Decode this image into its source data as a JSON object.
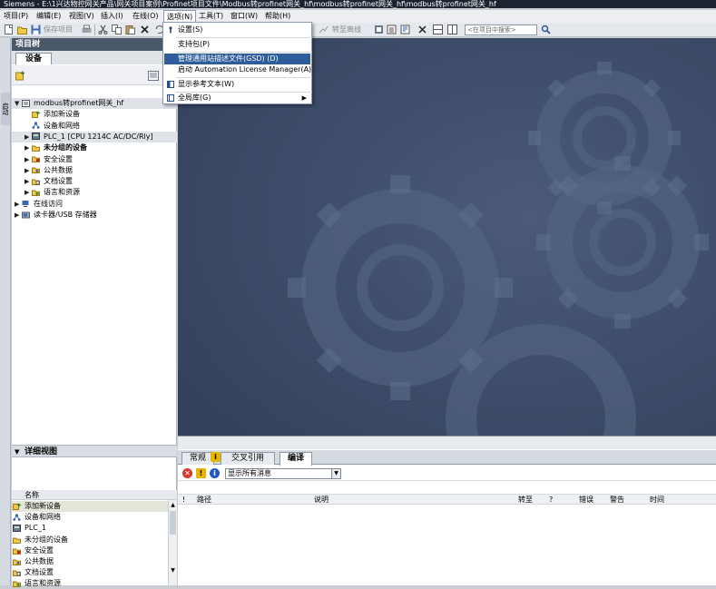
{
  "window": {
    "title": "Siemens  -  E:\\1兴达物控网关产品\\网关项目案例\\Profinet项目文件\\Modbus转profinet网关_hf\\modbus转profinet网关_hf\\modbus转profinet网关_hf"
  },
  "menubar": {
    "items": [
      "项目(P)",
      "编辑(E)",
      "视图(V)",
      "插入(I)",
      "在线(O)",
      "选项(N)",
      "工具(T)",
      "窗口(W)",
      "帮助(H)"
    ]
  },
  "toolbar": {
    "save_project": "保存项目",
    "go_offline": "转至离线",
    "search_placeholder": "<在项目中搜索>"
  },
  "options_menu": {
    "items": [
      {
        "label": "设置(S)",
        "icon": "settings-icon"
      },
      {
        "label": "支持包(P)",
        "icon": ""
      },
      {
        "label": "管理通用站描述文件(GSD) (D)",
        "icon": "",
        "highlighted": true
      },
      {
        "label": "启动 Automation License Manager(A)",
        "icon": ""
      },
      {
        "label": "显示参考文本(W)",
        "icon": "reference-text-icon"
      },
      {
        "label": "全局库(G)",
        "icon": "library-icon",
        "submenu": true
      }
    ]
  },
  "left_strip": {
    "label": "启动"
  },
  "project_tree": {
    "title": "项目树",
    "tab": "设备",
    "items": [
      {
        "label": "modbus转profinet网关_hf",
        "level": 0,
        "twisty": "open",
        "icon": "project-icon",
        "bold": false,
        "selected": true
      },
      {
        "label": "添加新设备",
        "level": 1,
        "twisty": "",
        "icon": "add-device-icon",
        "bold": false
      },
      {
        "label": "设备和网络",
        "level": 1,
        "twisty": "",
        "icon": "network-icon",
        "bold": false
      },
      {
        "label": "PLC_1 [CPU 1214C AC/DC/Rly]",
        "level": 1,
        "twisty": "closed",
        "icon": "plc-icon",
        "bold": false,
        "selected": true
      },
      {
        "label": "未分组的设备",
        "level": 1,
        "twisty": "closed",
        "icon": "folder-icon",
        "bold": true
      },
      {
        "label": "安全设置",
        "level": 1,
        "twisty": "closed",
        "icon": "security-icon",
        "bold": false
      },
      {
        "label": "公共数据",
        "level": 1,
        "twisty": "closed",
        "icon": "common-data-icon",
        "bold": false
      },
      {
        "label": "文档设置",
        "level": 1,
        "twisty": "closed",
        "icon": "document-icon",
        "bold": false
      },
      {
        "label": "语言和资源",
        "level": 1,
        "twisty": "closed",
        "icon": "language-icon",
        "bold": false
      },
      {
        "label": "在线访问",
        "level": 0,
        "twisty": "closed",
        "icon": "online-access-icon",
        "bold": false
      },
      {
        "label": "读卡器/USB 存储器",
        "level": 0,
        "twisty": "closed",
        "icon": "card-reader-icon",
        "bold": false
      }
    ]
  },
  "detail_view": {
    "title": "详细视图",
    "column": "名称",
    "items": [
      {
        "label": "添加新设备",
        "icon": "add-device-icon",
        "selected": true
      },
      {
        "label": "设备和网络",
        "icon": "network-icon"
      },
      {
        "label": "PLC_1",
        "icon": "plc-icon"
      },
      {
        "label": "未分组的设备",
        "icon": "folder-icon"
      },
      {
        "label": "安全设置",
        "icon": "security-icon"
      },
      {
        "label": "公共数据",
        "icon": "common-data-icon"
      },
      {
        "label": "文档设置",
        "icon": "document-icon"
      },
      {
        "label": "语言和资源",
        "icon": "language-icon"
      }
    ]
  },
  "inspector": {
    "tabs": [
      "常规",
      "交叉引用",
      "编译"
    ],
    "general_info_badge": "i",
    "active_tab": 2,
    "filter_value": "显示所有消息",
    "columns": [
      "!",
      "路径",
      "说明",
      "转至",
      "?",
      "错误",
      "警告",
      "时间"
    ]
  },
  "colors": {
    "accent": "#2f5d9c",
    "header": "#4a586c",
    "workspace": "#3b4a66",
    "error": "#d23a2f",
    "warning": "#e8b400",
    "info": "#1f55c8"
  }
}
